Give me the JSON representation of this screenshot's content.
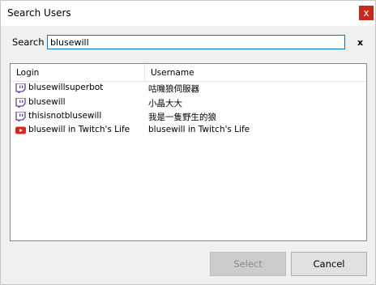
{
  "window": {
    "title": "Search Users",
    "close_glyph": "x"
  },
  "search": {
    "label": "Search",
    "value": "blusewill",
    "clear_glyph": "x"
  },
  "list": {
    "columns": [
      "Login",
      "Username"
    ],
    "rows": [
      {
        "icon": "twitch-icon",
        "login": "blusewillsuperbot",
        "username": "咕嘰狼伺服器"
      },
      {
        "icon": "twitch-icon",
        "login": "blusewill",
        "username": "小晶大大"
      },
      {
        "icon": "twitch-icon",
        "login": "thisisnotblusewill",
        "username": "我是一隻野生的狼"
      },
      {
        "icon": "youtube-icon",
        "login": "blusewill in Twitch's Life",
        "username": "blusewill in Twitch's Life"
      }
    ]
  },
  "buttons": {
    "select": "Select",
    "cancel": "Cancel"
  },
  "colors": {
    "twitch": "#6441a5",
    "youtube": "#e62117",
    "close": "#c42b1c",
    "focus": "#0078d7"
  }
}
